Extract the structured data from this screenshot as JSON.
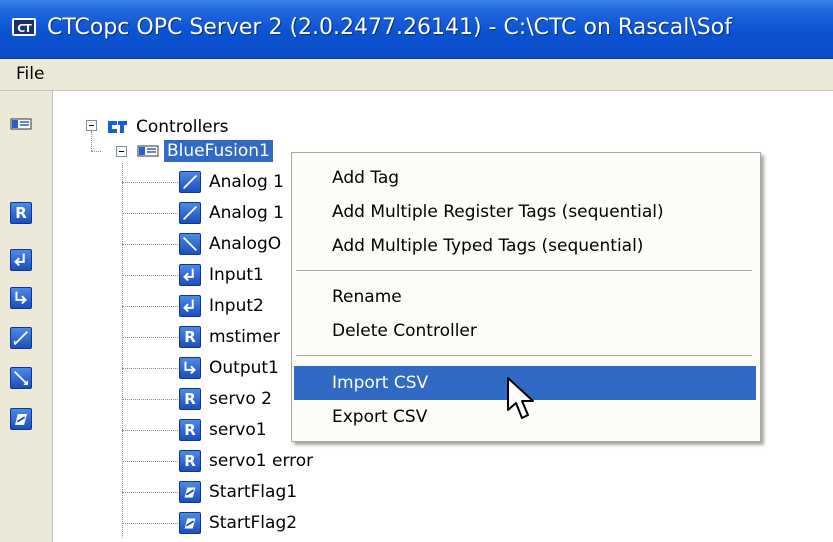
{
  "window": {
    "title": "CTCopc OPC Server 2 (2.0.2477.26141) - C:\\CTC on Rascal\\Sof",
    "icon_text": "CT"
  },
  "menu": {
    "file": "File"
  },
  "toolbar": {
    "buttons": [
      "controller-icon",
      "register-icon",
      "input-icon",
      "output-icon",
      "analog-in-icon",
      "analog-out-icon",
      "flag-icon"
    ]
  },
  "tree": {
    "root": {
      "label": "Controllers",
      "icon": "ct-logo-icon"
    },
    "controller": {
      "label": "BlueFusion1",
      "icon": "controller-icon"
    },
    "tags": [
      {
        "label": "Analog 1",
        "icon": "analog-in-icon"
      },
      {
        "label": "Analog 1",
        "icon": "analog-in-icon"
      },
      {
        "label": "AnalogO",
        "icon": "analog-out-icon"
      },
      {
        "label": "Input1",
        "icon": "input-icon"
      },
      {
        "label": "Input2",
        "icon": "input-icon"
      },
      {
        "label": "mstimer",
        "icon": "register-icon"
      },
      {
        "label": "Output1",
        "icon": "output-icon"
      },
      {
        "label": "servo 2",
        "icon": "register-icon"
      },
      {
        "label": "servo1",
        "icon": "register-icon"
      },
      {
        "label": "servo1 error",
        "icon": "register-icon"
      },
      {
        "label": "StartFlag1",
        "icon": "flag-icon"
      },
      {
        "label": "StartFlag2",
        "icon": "flag-icon"
      }
    ]
  },
  "context_menu": {
    "items": [
      {
        "label": "Add Tag"
      },
      {
        "label": "Add Multiple Register Tags (sequential)"
      },
      {
        "label": "Add Multiple Typed Tags (sequential)"
      },
      {
        "label": "Rename"
      },
      {
        "label": "Delete Controller"
      },
      {
        "label": "Import CSV",
        "highlighted": true
      },
      {
        "label": "Export CSV"
      }
    ]
  },
  "colors": {
    "titlebar": "#0b53d3",
    "selection": "#316ac5",
    "chrome": "#ece9d8"
  }
}
